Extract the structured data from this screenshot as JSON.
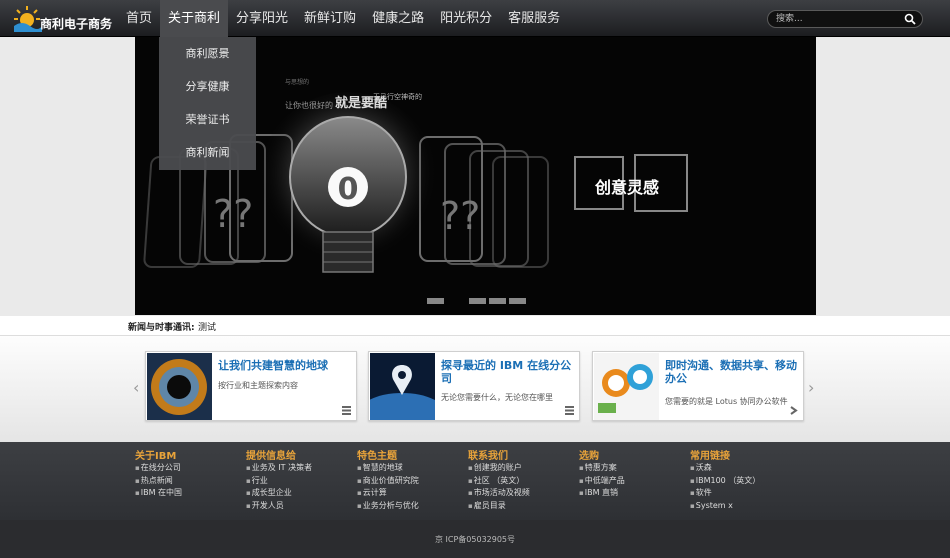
{
  "logo": {
    "text": "商利电子商务",
    "sun_color": "#f2b11e",
    "wave_color": "#2e8fd0"
  },
  "nav": {
    "items": [
      {
        "label": "首页"
      },
      {
        "label": "关于商利"
      },
      {
        "label": "分享阳光"
      },
      {
        "label": "新鲜订购"
      },
      {
        "label": "健康之路"
      },
      {
        "label": "阳光积分"
      },
      {
        "label": "客服服务"
      }
    ],
    "active_index": 1
  },
  "search": {
    "placeholder": "搜索..."
  },
  "dropdown": {
    "items": [
      {
        "label": "商利愿景"
      },
      {
        "label": "分享健康"
      },
      {
        "label": "荣誉证书"
      },
      {
        "label": "商利新闻"
      }
    ]
  },
  "banner": {
    "tag": "创意灵感",
    "headline": "就是要酷",
    "slogan": "天马行空神奇的",
    "small_text_1": "与思想的",
    "small_text_2": "让你也很好的",
    "bulb_glyph": "0",
    "slide_count": 4,
    "active_slide": 0
  },
  "news": {
    "label": "新闻与时事通讯:",
    "item": "测试"
  },
  "cards": [
    {
      "title": "让我们共建智慧的地球",
      "desc": "按行业和主题探索内容",
      "more_icon": "list-icon"
    },
    {
      "title": "探寻最近的 IBM 在线分公司",
      "desc": "无论您需要什么，无论您在哪里",
      "more_icon": "list-icon"
    },
    {
      "title": "即时沟通、数据共享、移动办公",
      "desc": "您需要的就是 Lotus 协同办公软件",
      "more_icon": "chevron-right-icon"
    }
  ],
  "footer": {
    "columns": [
      {
        "title": "关于IBM",
        "links": [
          "在线分公司",
          "热点新闻",
          "IBM 在中国"
        ]
      },
      {
        "title": "提供信息给",
        "links": [
          "业务及 IT 决策者",
          "行业",
          "成长型企业",
          "开发人员"
        ]
      },
      {
        "title": "特色主题",
        "links": [
          "智慧的地球",
          "商业价值研究院",
          "云计算",
          "业务分析与优化"
        ]
      },
      {
        "title": "联系我们",
        "links": [
          "创建我的账户",
          "社区 （英文）",
          "市场活动及视频",
          "雇员目录"
        ]
      },
      {
        "title": "选购",
        "links": [
          "特惠方案",
          "中低端产品",
          "IBM 直销"
        ]
      },
      {
        "title": "常用链接",
        "links": [
          "沃森",
          "IBM100 （英文）",
          "软件",
          "System x"
        ]
      }
    ],
    "icp": "京 ICP备05032905号"
  },
  "colors": {
    "accent": "#e8a33a",
    "card_title": "#1b6fb5",
    "nav_bg": "#2c2d31"
  }
}
